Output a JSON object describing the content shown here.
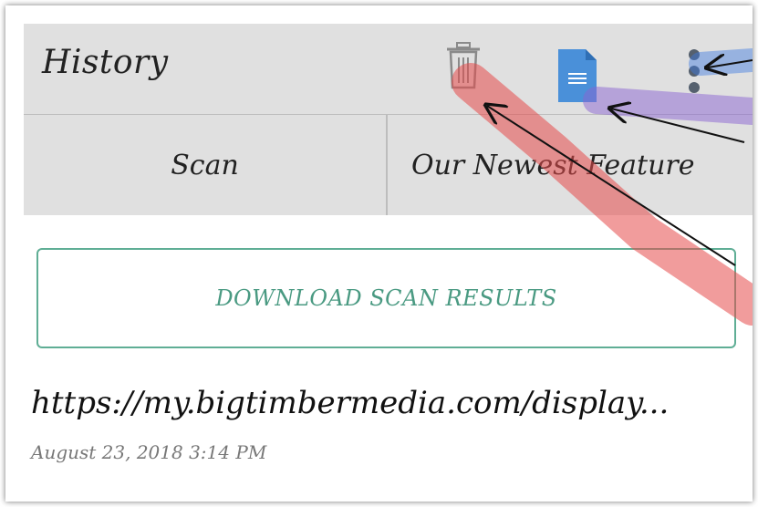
{
  "appbar": {
    "title": "History",
    "icons": [
      "trash-icon",
      "document-icon",
      "more-vert-icon"
    ],
    "doc_icon_color": "#4a90d9",
    "trash_icon_color": "#8a8a8a",
    "kebab_color": "#55606e"
  },
  "tabs": [
    {
      "label": "Scan"
    },
    {
      "label": "Our Newest Feature"
    }
  ],
  "download_button": {
    "label": "DOWNLOAD SCAN RESULTS",
    "color": "#4a9a82"
  },
  "history_item": {
    "url": "https://my.bigtimbermedia.com/display...",
    "timestamp": "August 23, 2018 3:14 PM"
  },
  "annotations": {
    "highlight_colors": [
      "#e54b4b",
      "#8a63d2",
      "#3d7be0"
    ]
  }
}
